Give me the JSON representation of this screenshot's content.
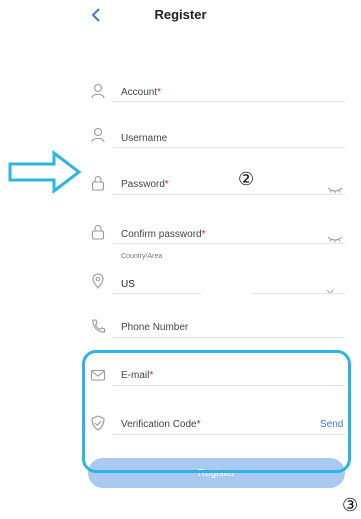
{
  "header": {
    "title": "Register",
    "back_icon": "chevron-left-icon"
  },
  "fields": {
    "account": {
      "label": "Account",
      "required": "*"
    },
    "username": {
      "label": "Username"
    },
    "password": {
      "label": "Password",
      "required": "*"
    },
    "confirm_password": {
      "label": "Confirm password",
      "required": "*"
    },
    "country": {
      "caption": "Country/Area",
      "value": "US"
    },
    "phone": {
      "label": "Phone Number"
    },
    "email": {
      "label": "E-mail",
      "required": "*"
    },
    "verification": {
      "label": "Verification Code",
      "required": "*",
      "send_label": "Send"
    }
  },
  "register_button": {
    "label": "Register"
  },
  "annotations": {
    "step_2": "②",
    "step_3": "③",
    "arrow_color": "#2bb5e6",
    "highlight_color": "#2bb5e6"
  },
  "colors": {
    "accent": "#3a7fd6",
    "button_bg": "#aac9f1",
    "required": "#e02020"
  }
}
